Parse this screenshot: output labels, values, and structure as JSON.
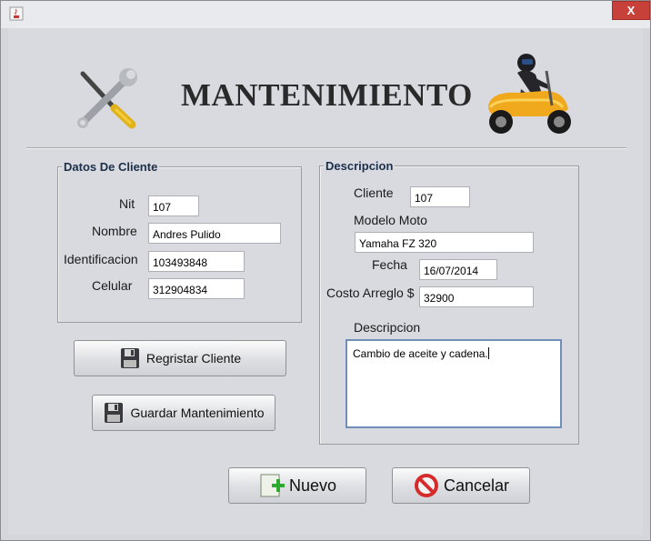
{
  "window": {
    "close_label": "X"
  },
  "header": {
    "title": "MANTENIMIENTO"
  },
  "client_group": {
    "legend": "Datos De Cliente",
    "nit_label": "Nit",
    "nit_value": "107",
    "nombre_label": "Nombre",
    "nombre_value": "Andres Pulido",
    "identificacion_label": "Identificacion",
    "identificacion_value": "103493848",
    "celular_label": "Celular",
    "celular_value": "312904834"
  },
  "description_group": {
    "legend": "Descripcion",
    "cliente_label": "Cliente",
    "cliente_value": "107",
    "modelo_label": "Modelo Moto",
    "modelo_value": "Yamaha FZ 320",
    "fecha_label": "Fecha",
    "fecha_value": "16/07/2014",
    "costo_label": "Costo Arreglo $",
    "costo_value": "32900",
    "descripcion_label": "Descripcion",
    "descripcion_value": "Cambio de aceite y cadena."
  },
  "buttons": {
    "registrar": "Regristar Cliente",
    "guardar": "Guardar Mantenimiento",
    "nuevo": "Nuevo",
    "cancelar": "Cancelar"
  },
  "icons": {
    "tools": "wrench-screwdriver-icon",
    "scooter": "scooter-rider-icon",
    "save": "floppy-disk-icon",
    "new": "new-document-icon",
    "cancel": "cancel-icon"
  }
}
